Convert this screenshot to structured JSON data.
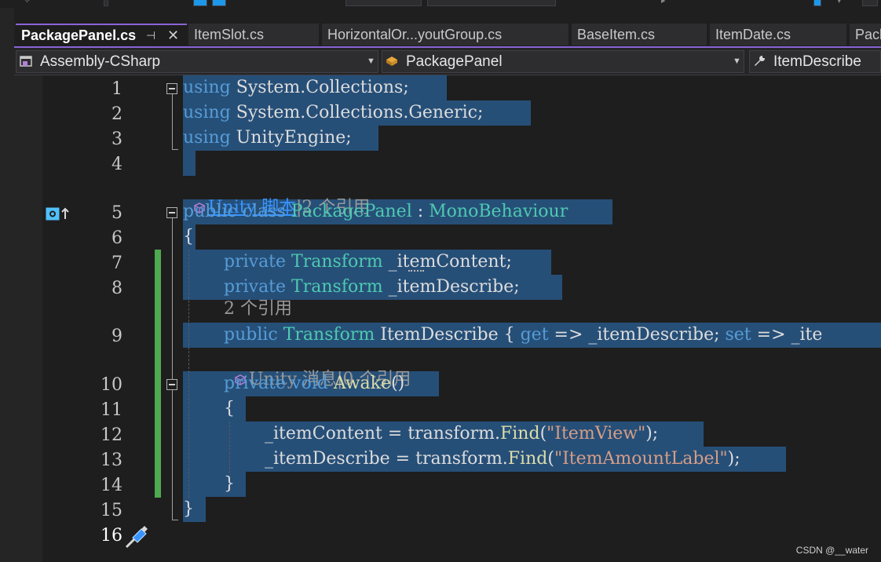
{
  "tabs": [
    {
      "label": "PackagePanel.cs",
      "active": true,
      "pin_icon": "pin-icon",
      "close_icon": "close-icon"
    },
    {
      "label": "ItemSlot.cs"
    },
    {
      "label": "HorizontalOr...youtGroup.cs"
    },
    {
      "label": "BaseItem.cs"
    },
    {
      "label": "ItemDate.cs"
    },
    {
      "label": "Pack"
    }
  ],
  "nav": {
    "project": "Assembly-CSharp",
    "type": "PackagePanel",
    "member": "ItemDescribe"
  },
  "codelens": {
    "class_lens_link": "Unity 脚本",
    "class_lens_refs": "|2 个引用",
    "prop_lens": "2 个引用",
    "awake_lens_label": "Unity 消息",
    "awake_lens_refs": "|0 个引用"
  },
  "lines": [
    {
      "n": "1"
    },
    {
      "n": "2"
    },
    {
      "n": "3"
    },
    {
      "n": "4"
    },
    {
      "n": "5"
    },
    {
      "n": "6"
    },
    {
      "n": "7"
    },
    {
      "n": "8"
    },
    {
      "n": "9"
    },
    {
      "n": "10"
    },
    {
      "n": "11"
    },
    {
      "n": "12"
    },
    {
      "n": "13"
    },
    {
      "n": "14"
    },
    {
      "n": "15"
    },
    {
      "n": "16"
    }
  ],
  "code": {
    "l1": {
      "kw": "using",
      "rest": " System.Collections;"
    },
    "l2": {
      "kw": "using",
      "rest": " System.Collections.Generic;"
    },
    "l3": {
      "kw": "using",
      "rest": " UnityEngine;"
    },
    "l5": {
      "kw1": "public",
      "kw2": " class ",
      "name": "PackagePanel",
      "sep": " : ",
      "base": "MonoBehaviour"
    },
    "l6": {
      "text": "{"
    },
    "l7": {
      "kw": "private ",
      "ty": "Transform",
      "rest": " _itemContent;"
    },
    "l8": {
      "kw": "private ",
      "ty": "Transform",
      "rest": " _itemDescribe;"
    },
    "l9": {
      "kw": "public ",
      "ty": "Transform",
      "rest1": " ItemDescribe { ",
      "get": "get",
      "rest2": " => _itemDescribe; ",
      "set": "set",
      "rest3": " => _ite"
    },
    "l10": {
      "kw": "private void ",
      "fn": "Awake",
      "rest": "()"
    },
    "l11": {
      "text": "{"
    },
    "l12": {
      "pre": "_itemContent = transform.",
      "fn": "Find",
      "open": "(",
      "str": "\"ItemView\"",
      "close": ");"
    },
    "l13": {
      "pre": "_itemDescribe = transform.",
      "fn": "Find",
      "open": "(",
      "str": "\"ItemAmountLabel\"",
      "close": ");"
    },
    "l14": {
      "text": "}"
    },
    "l15": {
      "text": "}"
    }
  },
  "watermark": "CSDN @__water",
  "colors": {
    "keyword": "#569cd6",
    "type": "#4ec9b0",
    "method": "#dcdcaa",
    "string": "#d69d85",
    "selection": "#264f78",
    "accent": "#8a64d6"
  }
}
